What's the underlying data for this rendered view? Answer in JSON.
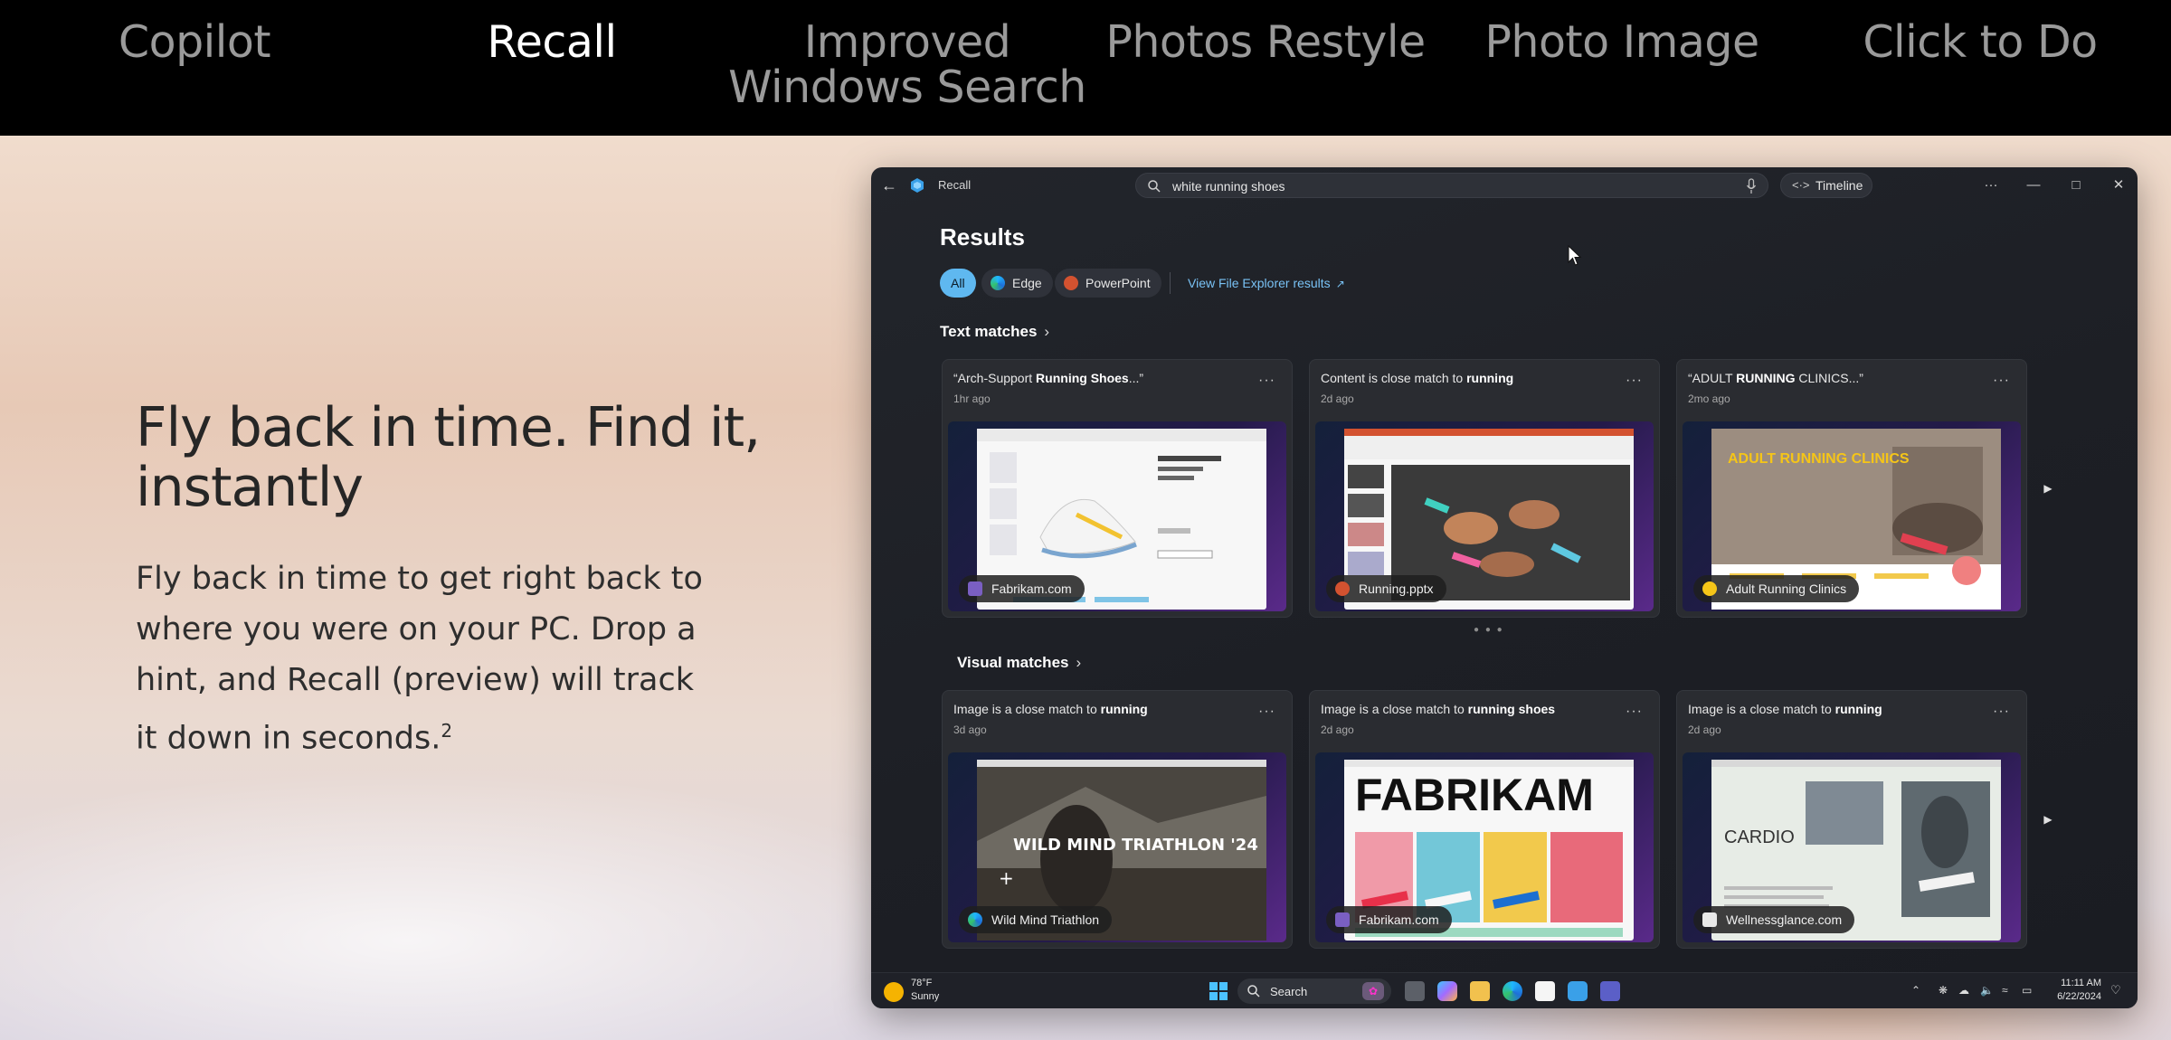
{
  "topnav": {
    "tabs": [
      {
        "label": "Copilot",
        "active": false
      },
      {
        "label": "Recall",
        "active": true
      },
      {
        "label": "Improved Windows Search",
        "active": false
      },
      {
        "label": "Photos Restyle",
        "active": false
      },
      {
        "label": "Photo Image",
        "active": false
      },
      {
        "label": "Click to Do",
        "active": false
      }
    ]
  },
  "hero": {
    "headline": "Fly back in time. Find it, instantly",
    "body": "Fly back in time to get right back to where you were on your PC. Drop a hint, and Recall (preview) will track it down in seconds.",
    "footnote": "2"
  },
  "window": {
    "app_name": "Recall",
    "search_value": "white running shoes",
    "timeline_label": "Timeline",
    "results_title": "Results",
    "filters": [
      {
        "label": "All",
        "selected": true
      },
      {
        "label": "Edge",
        "icon": "edge-icon"
      },
      {
        "label": "PowerPoint",
        "icon": "powerpoint-icon"
      }
    ],
    "file_explorer_link": "View File Explorer results",
    "text_matches": {
      "heading": "Text matches",
      "cards": [
        {
          "title_prefix": "“Arch-Support ",
          "title_bold": "Running Shoes",
          "title_suffix": "...”",
          "time": "1hr ago",
          "source": "Fabrikam.com",
          "source_color": "#7a5fc2"
        },
        {
          "title_prefix": "Content is close match to ",
          "title_bold": "running",
          "title_suffix": "",
          "time": "2d ago",
          "source": "Running.pptx",
          "source_color": "#d35230"
        },
        {
          "title_prefix": "“ADULT ",
          "title_bold": "RUNNING",
          "title_suffix": " CLINICS...”",
          "time": "2mo ago",
          "source": "Adult Running Clinics",
          "source_color": "#f5c518"
        }
      ]
    },
    "visual_matches": {
      "heading": "Visual matches",
      "cards": [
        {
          "title_prefix": "Image is a close match to ",
          "title_bold": "running",
          "time": "3d ago",
          "source": "Wild Mind Triathlon",
          "source_color": "#2fa7d8",
          "overlay": "WILD MIND TRIATHLON '24"
        },
        {
          "title_prefix": "Image is a close match to ",
          "title_bold": "running shoes",
          "time": "2d ago",
          "source": "Fabrikam.com",
          "source_color": "#7a5fc2",
          "overlay": "FABRIKAM"
        },
        {
          "title_prefix": "Image is a close match to ",
          "title_bold": "running",
          "time": "2d ago",
          "source": "Wellnessglance.com",
          "source_color": "#e8e8e8",
          "overlay": "CARDIO"
        }
      ]
    },
    "text_thumb_labels": {
      "arch_title": "Arch Support Running Shoes",
      "adult_running": "ADULT RUNNING CLINICS"
    },
    "taskbar": {
      "temperature": "78°F",
      "condition": "Sunny",
      "search_label": "Search",
      "time": "11:11 AM",
      "date": "6/22/2024"
    }
  }
}
